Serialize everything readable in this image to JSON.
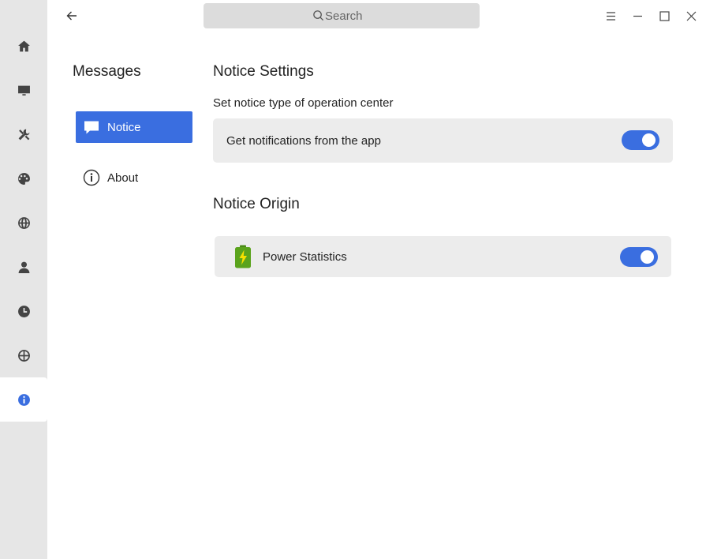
{
  "window": {
    "search_placeholder": "Search",
    "back_icon": "arrow-left-icon",
    "menu_icon": "hamburger-icon",
    "minimize_icon": "minimize-icon",
    "maximize_icon": "maximize-icon",
    "close_icon": "close-icon"
  },
  "rail": {
    "items": [
      {
        "icon": "home-icon",
        "active": false
      },
      {
        "icon": "monitor-icon",
        "active": false
      },
      {
        "icon": "tools-icon",
        "active": false
      },
      {
        "icon": "palette-icon",
        "active": false
      },
      {
        "icon": "globe-icon",
        "active": false
      },
      {
        "icon": "user-icon",
        "active": false
      },
      {
        "icon": "clock-icon",
        "active": false
      },
      {
        "icon": "update-icon",
        "active": false
      },
      {
        "icon": "info-icon",
        "active": true
      }
    ]
  },
  "sidebar": {
    "title": "Messages",
    "items": [
      {
        "label": "Notice",
        "icon": "chat-bubble-icon",
        "active": true
      },
      {
        "label": "About",
        "icon": "info-circle-icon",
        "active": false
      }
    ]
  },
  "main": {
    "notice_settings": {
      "title": "Notice Settings",
      "subtitle": "Set notice type of operation center",
      "toggle_label": "Get notifications from the app",
      "toggle_on": true
    },
    "notice_origin": {
      "title": "Notice Origin",
      "apps": [
        {
          "label": "Power Statistics",
          "icon": "battery-charging-icon",
          "enabled": true
        }
      ]
    }
  },
  "colors": {
    "accent": "#3a6ee0",
    "rail_bg": "#e6e6e6",
    "card_bg": "#ececec",
    "battery_green": "#5aa31c",
    "bolt_yellow": "#f5e000"
  }
}
